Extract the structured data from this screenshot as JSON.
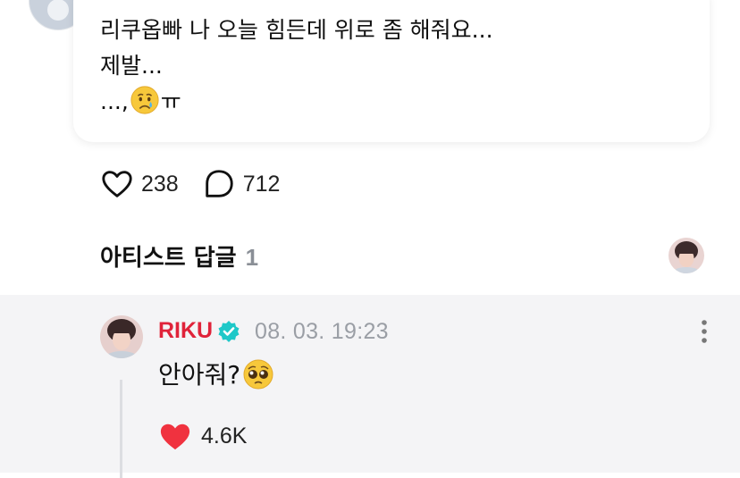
{
  "post": {
    "lines": [
      "리쿠옵빠 나 오늘 힘든데 위로 좀 해줘요...",
      "제발..."
    ],
    "line3_prefix": "...,",
    "line3_suffix": "ㅠ",
    "emoji": "crying-face"
  },
  "actions": {
    "likes": "238",
    "comments": "712"
  },
  "artist_replies": {
    "title": "아티스트 답글",
    "count": "1"
  },
  "reply": {
    "author": "RIKU",
    "date": "08. 03. 19:23",
    "text": "안아줘?",
    "emoji": "pleading-face",
    "likes": "4.6K"
  },
  "colors": {
    "brand_red": "#e0233a",
    "verified": "#1ec8c8",
    "like_heart": "#f0323f"
  }
}
